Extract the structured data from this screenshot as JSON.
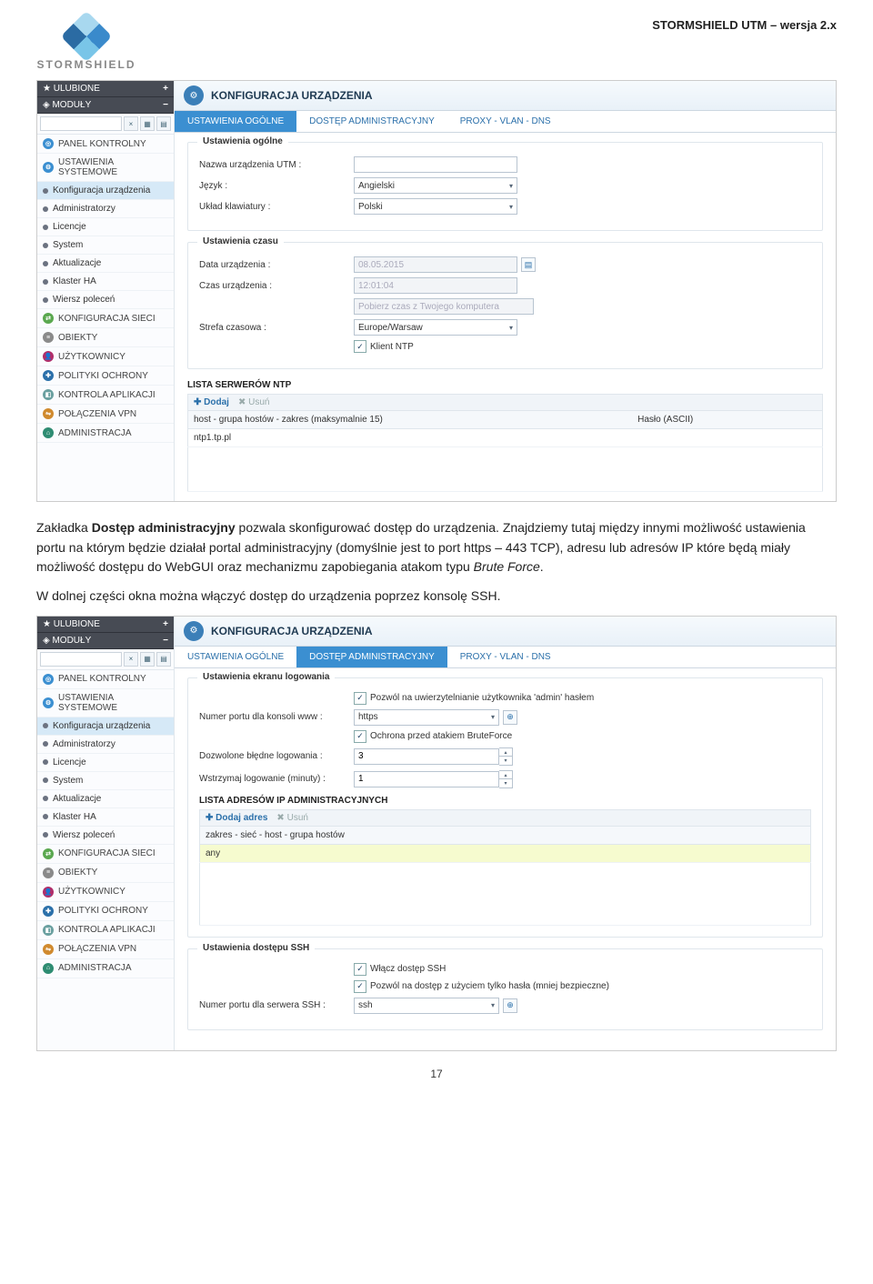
{
  "doc": {
    "header": "STORMSHIELD UTM – wersja 2.x",
    "brand": "STORMSHIELD",
    "page_number": "17"
  },
  "paragraphs": {
    "p1_pre": "Zakładka ",
    "p1_b": "Dostęp administracyjny",
    "p1_post": " pozwala skonfigurować dostęp do urządzenia. Znajdziemy tutaj między innymi możliwość ustawienia portu na którym będzie działał portal administracyjny (domyślnie jest to port https – 443 TCP), adresu lub adresów IP które będą miały możliwość dostępu do WebGUI oraz mechanizmu zapobiegania atakom typu ",
    "p1_i": "Brute Force",
    "p1_end": ".",
    "p2": "W dolnej części okna można włączyć dostęp do urządzenia poprzez konsolę SSH."
  },
  "sidebar": {
    "fav": "ULUBIONE",
    "mod": "MODUŁY",
    "items": [
      {
        "label": "PANEL KONTROLNY",
        "ico": "#3b8fd1",
        "t": "◎"
      },
      {
        "label": "USTAWIENIA SYSTEMOWE",
        "ico": "#3b8fd1",
        "t": "⚙"
      },
      {
        "label": "Konfiguracja urządzenia",
        "bullet": true,
        "active": true
      },
      {
        "label": "Administratorzy",
        "bullet": true
      },
      {
        "label": "Licencje",
        "bullet": true
      },
      {
        "label": "System",
        "bullet": true
      },
      {
        "label": "Aktualizacje",
        "bullet": true
      },
      {
        "label": "Klaster HA",
        "bullet": true
      },
      {
        "label": "Wiersz poleceń",
        "bullet": true
      },
      {
        "label": "KONFIGURACJA SIECI",
        "ico": "#5aa84f",
        "t": "⇄"
      },
      {
        "label": "OBIEKTY",
        "ico": "#8a8a8a",
        "t": "≡"
      },
      {
        "label": "UŻYTKOWNICY",
        "ico": "#b02e6a",
        "t": "👤"
      },
      {
        "label": "POLITYKI OCHRONY",
        "ico": "#2b70aa",
        "t": "✚"
      },
      {
        "label": "KONTROLA APLIKACJI",
        "ico": "#6aa0a0",
        "t": "◧"
      },
      {
        "label": "POŁĄCZENIA VPN",
        "ico": "#d08a2e",
        "t": "⇋"
      },
      {
        "label": "ADMINISTRACJA",
        "ico": "#2e8c72",
        "t": "⌂"
      }
    ]
  },
  "ss1": {
    "title": "KONFIGURACJA URZĄDZENIA",
    "tabs": [
      "USTAWIENIA OGÓLNE",
      "DOSTĘP ADMINISTRACYJNY",
      "PROXY - VLAN - DNS"
    ],
    "active_tab": 0,
    "fs1": {
      "legend": "Ustawienia ogólne",
      "name_label": "Nazwa urządzenia UTM :",
      "name_value": "",
      "lang_label": "Język :",
      "lang_value": "Angielski",
      "kb_label": "Układ klawiatury :",
      "kb_value": "Polski"
    },
    "fs2": {
      "legend": "Ustawienia czasu",
      "date_label": "Data urządzenia :",
      "date_value": "08.05.2015",
      "time_label": "Czas urządzenia :",
      "time_value": "12:01:04",
      "btn_get": "Pobierz czas z Twojego komputera",
      "tz_label": "Strefa czasowa :",
      "tz_value": "Europe/Warsaw",
      "ntp_chk": "Klient NTP"
    },
    "ntp": {
      "heading": "LISTA SERWERÓW NTP",
      "add": "Dodaj",
      "del": "Usuń",
      "col1": "host - grupa hostów - zakres (maksymalnie 15)",
      "col2": "Hasło (ASCII)",
      "row1": "ntp1.tp.pl"
    }
  },
  "ss2": {
    "title": "KONFIGURACJA URZĄDZENIA",
    "tabs": [
      "USTAWIENIA OGÓLNE",
      "DOSTĘP ADMINISTRACYJNY",
      "PROXY - VLAN - DNS"
    ],
    "active_tab": 1,
    "fs1": {
      "legend": "Ustawienia ekranu logowania",
      "chk1": "Pozwól na uwierzytelnianie użytkownika 'admin' hasłem",
      "port_label": "Numer portu dla konsoli www :",
      "port_value": "https",
      "chk2": "Ochrona przed atakiem BruteForce",
      "fail_label": "Dozwolone błędne logowania :",
      "fail_value": "3",
      "hold_label": "Wstrzymaj logowanie (minuty) :",
      "hold_value": "1"
    },
    "ips": {
      "heading": "LISTA ADRESÓW IP ADMINISTRACYJNYCH",
      "add": "Dodaj adres",
      "del": "Usuń",
      "col1": "zakres - sieć - host - grupa hostów",
      "row1": "any"
    },
    "fs2": {
      "legend": "Ustawienia dostępu SSH",
      "chk1": "Włącz dostęp SSH",
      "chk2": "Pozwól na dostęp z użyciem tylko hasła (mniej bezpieczne)",
      "port_label": "Numer portu dla serwera SSH :",
      "port_value": "ssh"
    }
  }
}
